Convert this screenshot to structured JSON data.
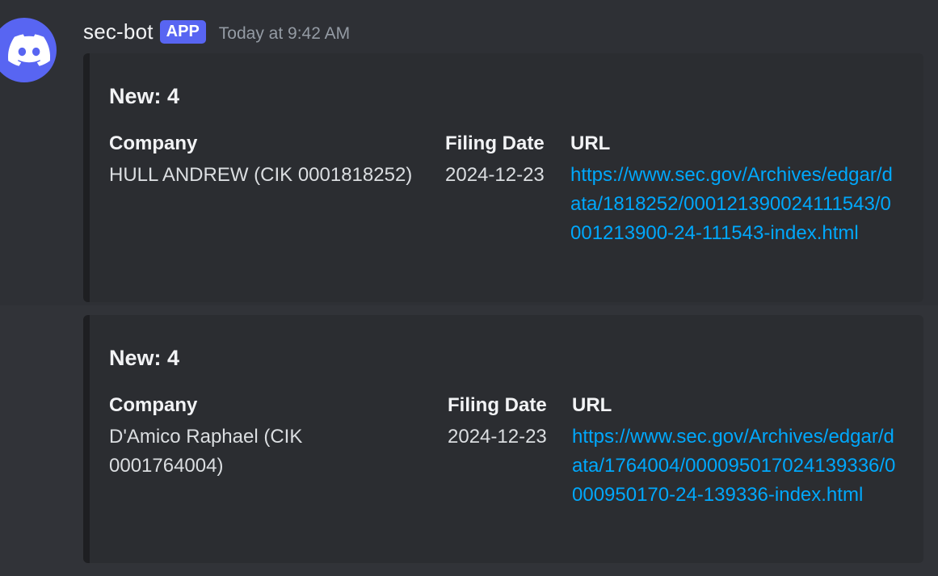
{
  "message": {
    "username": "sec-bot",
    "badge": "APP",
    "timestamp": "Today at 9:42 AM",
    "avatar_icon": "discord-logo-icon",
    "accent_color": "#5865f2"
  },
  "embeds": [
    {
      "title": "New: 4",
      "fields": {
        "company_name": "Company",
        "company_value": "HULL ANDREW (CIK 0001818252)",
        "date_name": "Filing Date",
        "date_value": "2024-12-23",
        "url_name": "URL",
        "url_value": "https://www.sec.gov/Archives/edgar/data/1818252/000121390024111543/0001213900-24-111543-index.html"
      }
    },
    {
      "title": "New: 4",
      "fields": {
        "company_name": "Company",
        "company_value": "D'Amico Raphael (CIK 0001764004)",
        "date_name": "Filing Date",
        "date_value": "2024-12-23",
        "url_name": "URL",
        "url_value": "https://www.sec.gov/Archives/edgar/data/1764004/000095017024139336/0000950170-24-139336-index.html"
      }
    }
  ],
  "link_color": "#00a8fc"
}
